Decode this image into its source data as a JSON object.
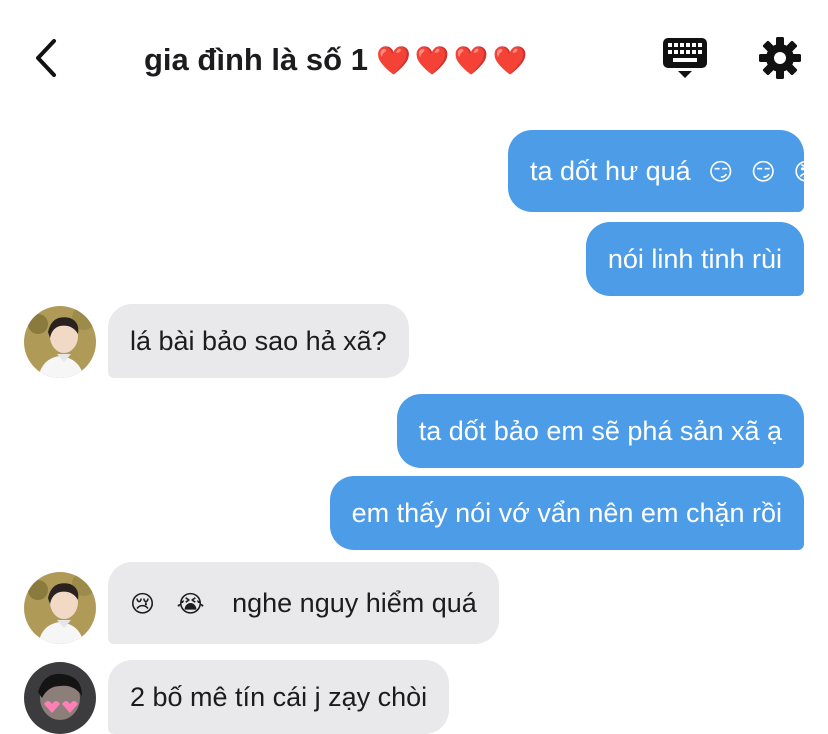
{
  "header": {
    "title": "gia đình là số 1",
    "title_hearts": "❤️❤️❤️❤️"
  },
  "messages": [
    {
      "dir": "out",
      "text": "ta dốt hư quá",
      "emojis": [
        "😏",
        "😏",
        "😡"
      ]
    },
    {
      "dir": "out",
      "text": "nói linh tinh rùi"
    },
    {
      "dir": "in",
      "text": "lá bài bảo sao hả xã?",
      "avatar": "boy-profile-avatar"
    },
    {
      "dir": "out",
      "text": "ta dốt bảo em sẽ phá sản xã ạ"
    },
    {
      "dir": "out",
      "text": "em thấy nói vớ vẩn nên em chặn rồi"
    },
    {
      "dir": "in",
      "text": "nghe nguy hiểm quá",
      "emojis": [
        "😢",
        "😭"
      ],
      "avatar": "boy-profile-avatar"
    },
    {
      "dir": "in",
      "text": "2 bố mê tín cái j zạy chòi",
      "avatar": "boy-hearts-avatar"
    }
  ],
  "colors": {
    "outgoing_bubble": "#4d9ce8",
    "incoming_bubble": "#e9e9ec",
    "text_dark": "#1c1c1e",
    "text_light": "#ffffff"
  },
  "icons": [
    "back-chevron-icon",
    "keyboard-icon",
    "gear-icon"
  ]
}
